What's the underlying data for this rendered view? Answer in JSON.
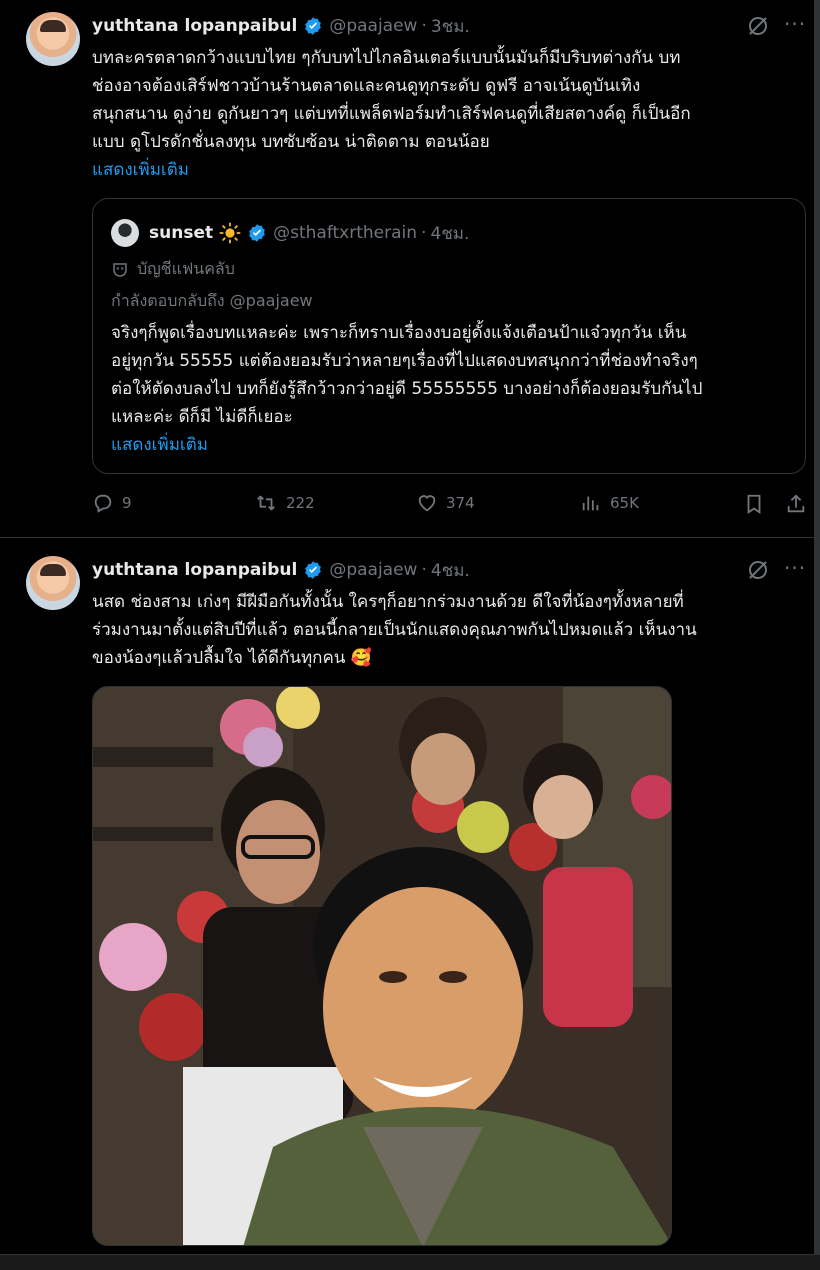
{
  "post1": {
    "name": "yuthtana lopanpaibul",
    "handle": "@paajaew",
    "time": "3ชม.",
    "text_lines": [
      "บทละครตลาดกว้างแบบไทย ๆกับบทไปไกลอินเตอร์แบบนั้นมันก็มีบริบทต่างกัน บท",
      "ช่องอาจต้องเสิร์ฟชาวบ้านร้านตลาดและคนดูทุกระดับ ดูฟรี  อาจเน้นดูบันเทิง",
      "สนุกสนาน ดูง่าย ดูกันยาวๆ แต่บทที่แพล็ตฟอร์มทำเสิร์ฟคนดูที่เสียสตางค์ดู ก็เป็นอีก",
      "แบบ  ดูโปรดักชั่นลงทุน บทซับซ้อน  น่าติดตาม ตอนน้อย"
    ],
    "show_more": "แสดงเพิ่มเติม",
    "quote": {
      "name": "sunset",
      "handle": "@sthaftxrtherain",
      "time": "4ชม.",
      "fan_label": "บัญชีแฟนคลับ",
      "replying_to": "กำลังตอบกลับถึง @paajaew",
      "text_lines": [
        "จริงๆก็พูดเรื่องบทแหละค่ะ เพราะก็ทราบเรื่องงบอยู่ดั้งแจ้งเตือนป้าแจ๋วทุกวัน เห็น",
        "อยู่ทุกวัน 55555 แต่ต้องยอมรับว่าหลายๆเรื่องที่ไปแสดงบทสนุกกว่าที่ช่องทำจริงๆ",
        "ต่อให้ตัดงบลงไป บทก็ยังรู้สึกว้าวกว่าอยู่ดี 55555555 บางอย่างก็ต้องยอมรับกันไป",
        "แหละค่ะ ดีก็มี ไม่ดีก็เยอะ"
      ],
      "show_more": "แสดงเพิ่มเติม"
    },
    "actions": {
      "replies": "9",
      "reposts": "222",
      "likes": "374",
      "views": "65K"
    }
  },
  "post2": {
    "name": "yuthtana lopanpaibul",
    "handle": "@paajaew",
    "time": "4ชม.",
    "text_lines": [
      "นสด  ช่องสาม เก่งๆ มีฝีมือกันทั้งนั้น  ใครๆก็อยากร่วมงานด้วย  ดีใจที่น้องๆทั้งหลายที่",
      "ร่วมงานมาตั้งแต่สิบปีที่แล้ว  ตอนนี้กลายเป็นนักแสดงคุณภาพกันไปหมดแล้ว  เห็นงาน",
      "ของน้องๆแล้วปลื้มใจ   ได้ดีกันทุกคน 🥰"
    ]
  },
  "colors": {
    "accent": "#1d9bf0",
    "muted": "#71767b",
    "text": "#e7e9ea",
    "border": "#2f3336",
    "background": "#000000"
  }
}
